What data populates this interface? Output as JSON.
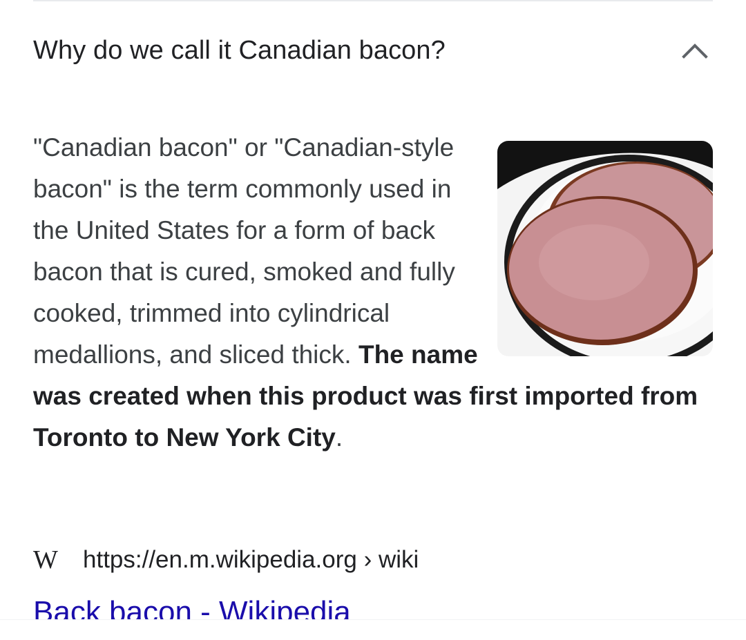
{
  "faq": {
    "question": "Why do we call it Canadian bacon?",
    "expand_icon": "chevron-up-icon",
    "answer_plain": "\"Canadian bacon\" or \"Canadian-style bacon\" is the term commonly used in the United States for a form of back bacon that is cured, smoked and fully cooked, trimmed into cylindrical medallions, and sliced thick. ",
    "answer_bold": "The name was created when this product was first imported from Toronto to New York City",
    "answer_end": ".",
    "image_icon": "sliced-canadian-bacon-image"
  },
  "source": {
    "logo_text": "W",
    "url": "https://en.m.wikipedia.org › wiki"
  },
  "result": {
    "title": "Back bacon - Wikipedia"
  },
  "colors": {
    "link": "#1a0dab",
    "text": "#3c4043",
    "divider": "#e8eaed"
  }
}
